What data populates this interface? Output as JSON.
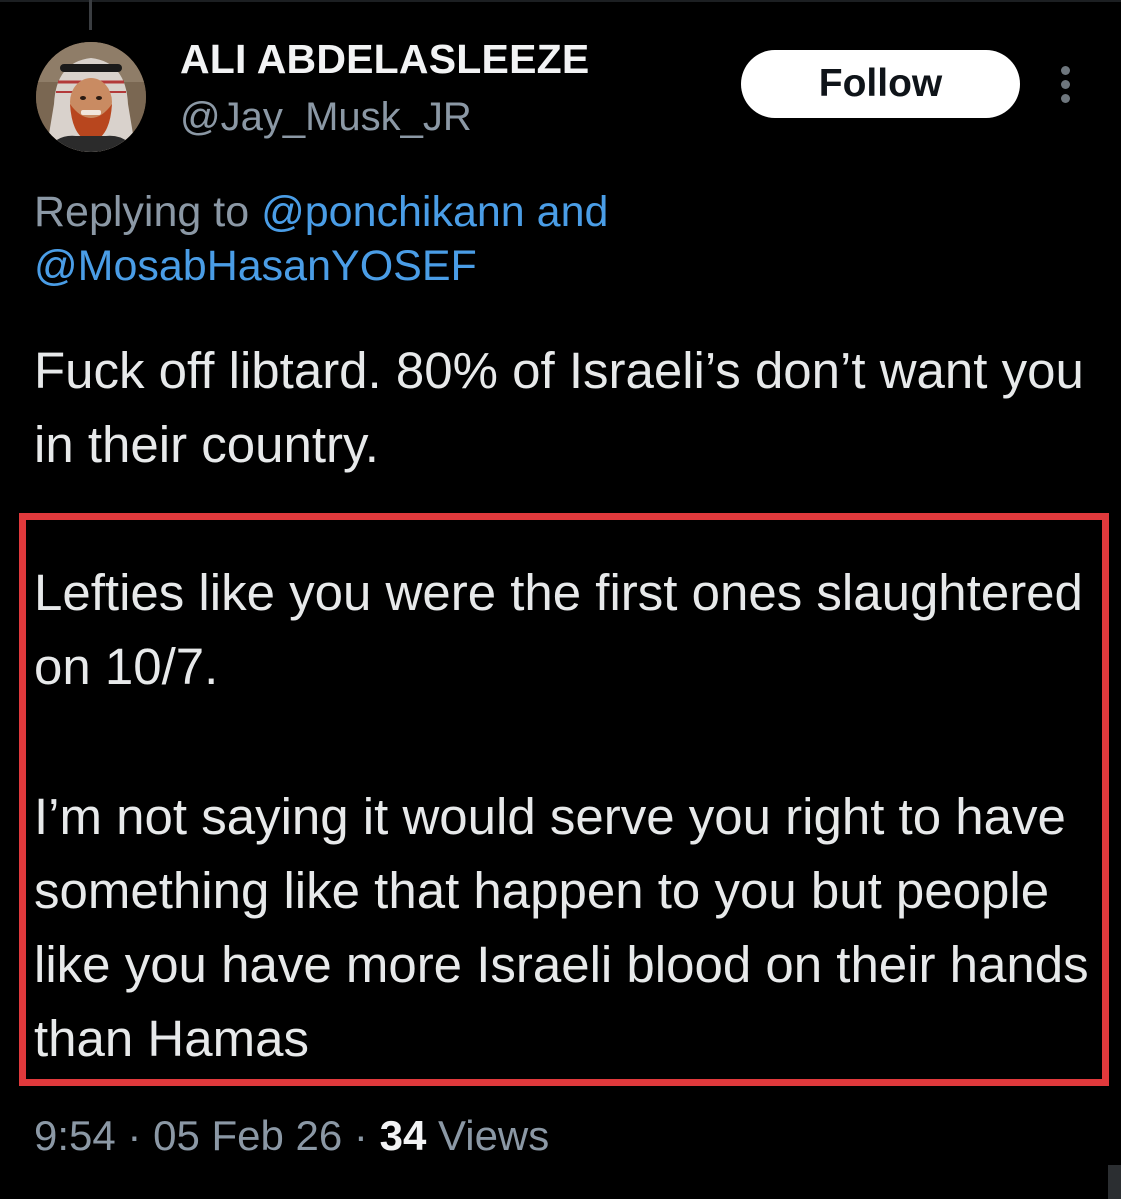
{
  "tweet": {
    "author_name": "ALI ABDELASLEEZE",
    "author_handle": "@Jay_Musk_JR",
    "follow_label": "Follow",
    "replying_prefix": "Replying to",
    "reply_to_1": "@ponchikann",
    "reply_joiner": "and",
    "reply_to_2": "@MosabHasanYOSEF",
    "paragraph_1": "Fuck off libtard. 80% of Israeli’s don’t want you in their country.",
    "paragraph_2": "Lefties like you were the first ones slaughtered on 10/7.",
    "paragraph_3": "I’m not saying it would serve you right to have something like that happen to you but people like you have more Israeli blood on their hands than Hamas",
    "time": "9:54",
    "date": "05 Feb 26",
    "separator": "·",
    "views_count": "34",
    "views_label": "Views"
  },
  "icons": {
    "more": "more-vertical-icon",
    "avatar": "profile-avatar"
  },
  "colors": {
    "background": "#000000",
    "text": "#e7e9ea",
    "secondary_text": "#8b98a5",
    "mention": "#4a9de6",
    "highlight_border": "#e0393c",
    "follow_button_bg": "#ffffff"
  }
}
